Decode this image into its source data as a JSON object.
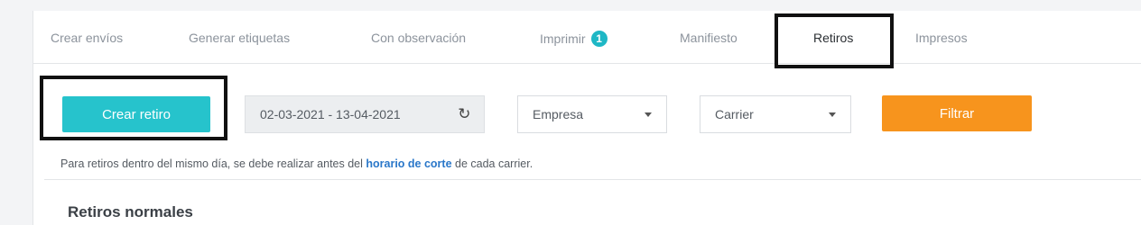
{
  "tabs": [
    {
      "label": "Crear envíos"
    },
    {
      "label": "Generar etiquetas"
    },
    {
      "label": "Con observación"
    },
    {
      "label": "Imprimir",
      "badge": "1"
    },
    {
      "label": "Manifiesto"
    },
    {
      "label": "Retiros",
      "active": true
    },
    {
      "label": "Impresos"
    }
  ],
  "toolbar": {
    "create_label": "Crear retiro",
    "date_range": "02-03-2021 - 13-04-2021",
    "refresh_icon": "refresh-icon",
    "company_select": "Empresa",
    "carrier_select": "Carrier",
    "filter_label": "Filtrar"
  },
  "note": {
    "before": "Para retiros dentro del mismo día, se debe realizar antes del ",
    "link": "horario de corte",
    "after": " de cada carrier."
  },
  "section": {
    "title": "Retiros normales"
  },
  "colors": {
    "accent": "#26c3cc",
    "filter": "#f7941d",
    "badge": "#1fb7c5",
    "link": "#2a77c9"
  }
}
